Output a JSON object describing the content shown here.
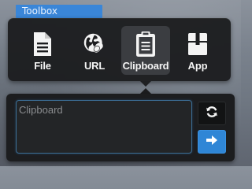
{
  "window": {
    "title": "Toolbox"
  },
  "menu": {
    "items": [
      {
        "label": "File",
        "icon": "file-icon",
        "active": false
      },
      {
        "label": "URL",
        "icon": "globe-link-icon",
        "active": false
      },
      {
        "label": "Clipboard",
        "icon": "clipboard-icon",
        "active": true
      },
      {
        "label": "App",
        "icon": "box-icon",
        "active": false
      }
    ]
  },
  "input": {
    "placeholder": "Clipboard",
    "value": ""
  },
  "buttons": {
    "refresh_icon": "refresh-icon",
    "go_icon": "arrow-right-icon"
  },
  "colors": {
    "accent": "#2f86d6",
    "tab": "#3a86d8",
    "panel": "#1c1d1f",
    "active_item": "#3b3d41"
  }
}
